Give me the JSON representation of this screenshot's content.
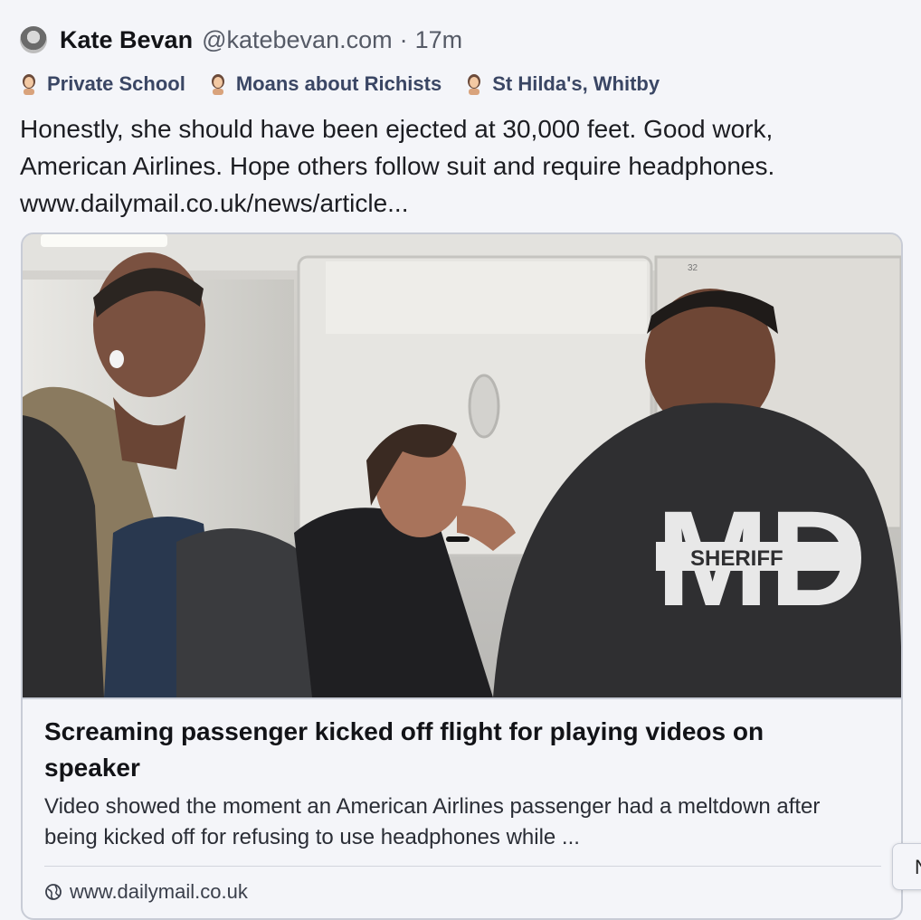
{
  "post": {
    "author": {
      "display_name": "Kate Bevan",
      "handle": "@katebevan.com",
      "separator": "·",
      "time": "17m",
      "avatar_icon": "avatar-image"
    },
    "badges": [
      {
        "label": "Private School",
        "icon": "person-emoji-icon"
      },
      {
        "label": "Moans about Richists",
        "icon": "person-emoji-icon"
      },
      {
        "label": "St Hilda's, Whitby",
        "icon": "person-emoji-icon"
      }
    ],
    "text_line1": "Honestly, she should have been ejected at 30,000 feet. Good work,",
    "text_line2": "American Airlines. Hope others follow suit and require headphones.",
    "link_text": "www.dailymail.co.uk/news/article..."
  },
  "card": {
    "title": "Screaming passenger kicked off flight for playing videos on speaker",
    "description": "Video showed the moment an American Airlines passenger had a meltdown after being kicked off for refusing to use headphones while ...",
    "domain": "www.dailymail.co.uk",
    "image": {
      "jacket_letters": "MD",
      "jacket_text": "SHERIFF",
      "bin_label": "32"
    }
  },
  "side_tab": {
    "label": "N"
  },
  "colors": {
    "background": "#f4f5f9",
    "text": "#1c1d22",
    "muted": "#555a66",
    "badge": "#3a4664",
    "border": "#c8ccd6"
  }
}
